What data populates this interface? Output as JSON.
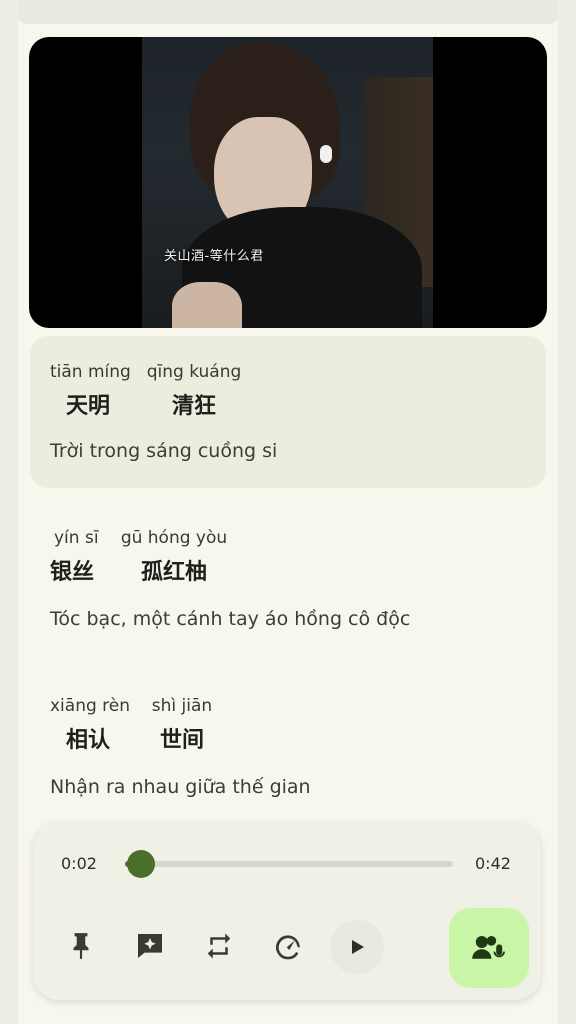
{
  "video": {
    "caption": "关山酒-等什么君"
  },
  "lyrics": [
    {
      "words": [
        {
          "pinyin": "tiān míng",
          "hanzi": "天明"
        },
        {
          "pinyin": "qīng kuáng",
          "hanzi": "清狂"
        }
      ],
      "translation": "Trời trong sáng cuồng si"
    },
    {
      "words": [
        {
          "pinyin": "yín sī",
          "hanzi": "银丝"
        },
        {
          "pinyin": "gū hóng yòu",
          "hanzi": "孤红柚"
        }
      ],
      "translation": "Tóc bạc, một cánh tay áo hồng cô độc"
    },
    {
      "words": [
        {
          "pinyin": "xiāng rèn",
          "hanzi": "相认"
        },
        {
          "pinyin": "shì jiān",
          "hanzi": "世间"
        }
      ],
      "translation": "Nhận ra nhau giữa thế gian"
    }
  ],
  "player": {
    "current_time": "0:02",
    "total_time": "0:42",
    "progress": 0.05,
    "accent_color": "#4a6e2c",
    "controls": [
      "pin-icon",
      "sparkle-comment-icon",
      "repeat-icon",
      "speed-icon",
      "play-icon",
      "voice-record-icon"
    ]
  }
}
